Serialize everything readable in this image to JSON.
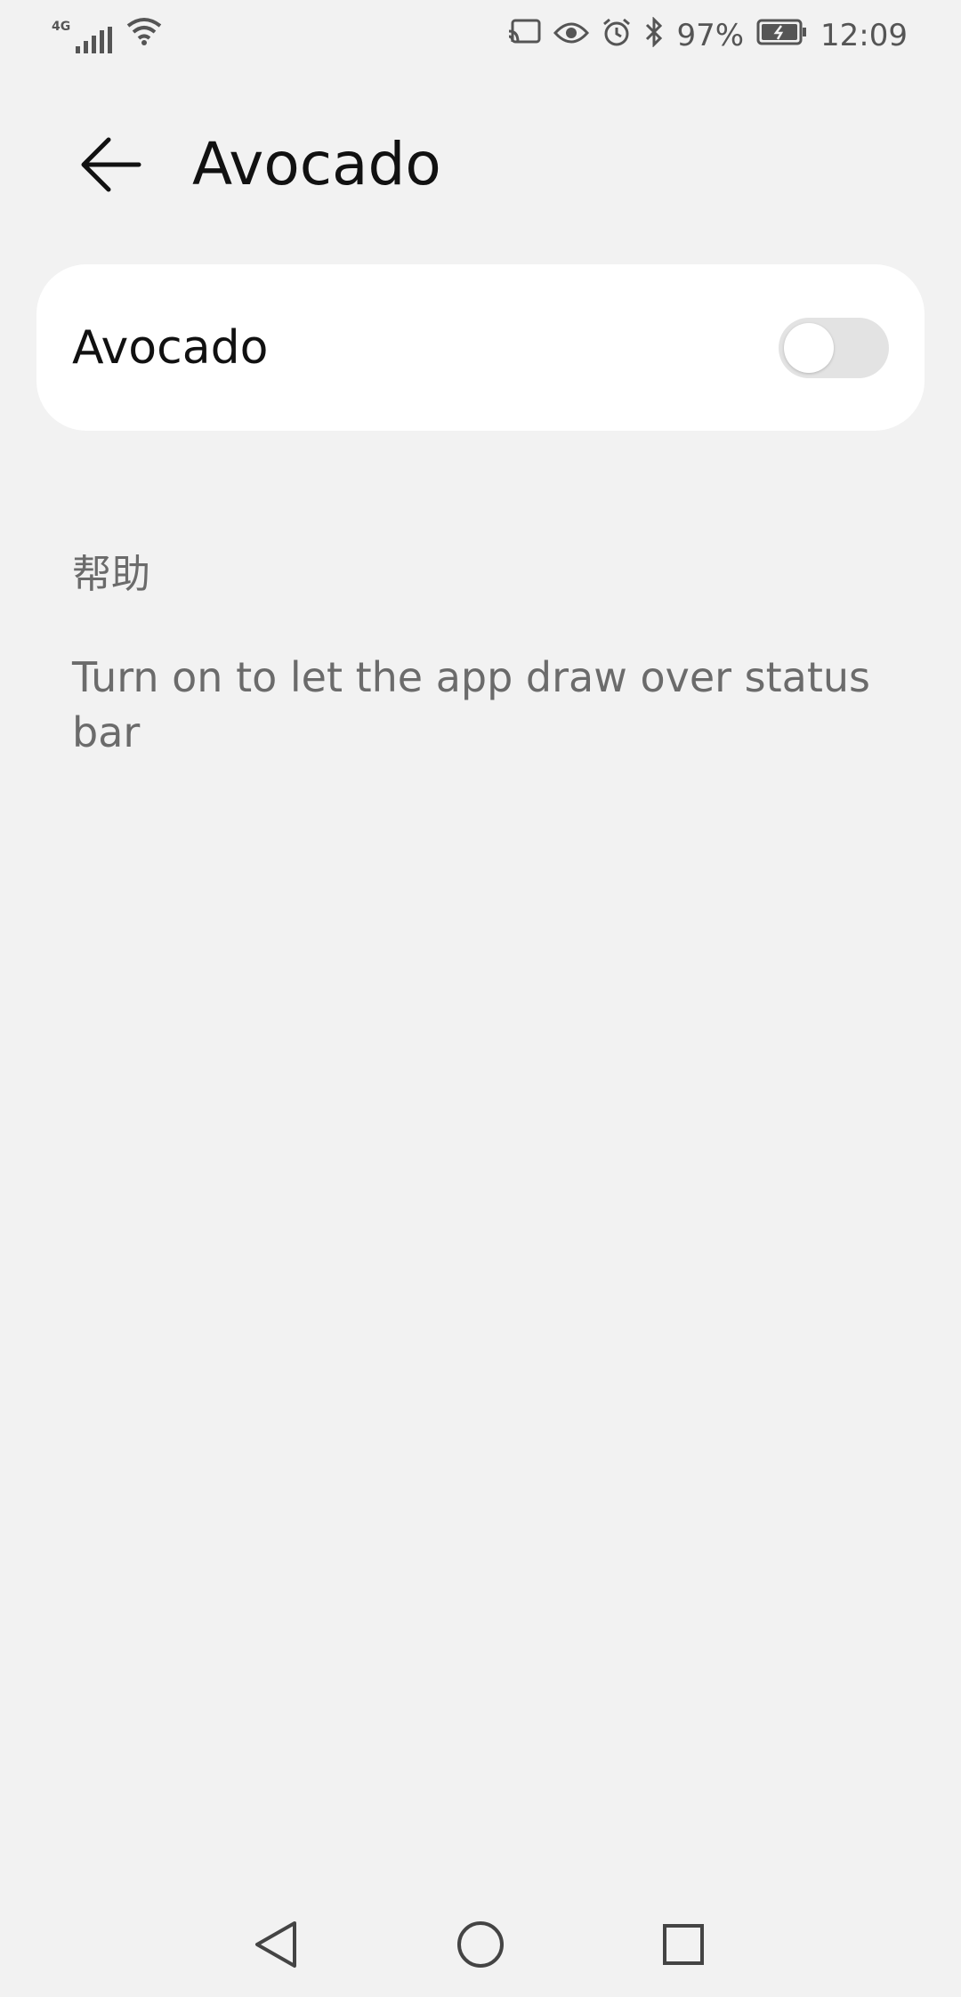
{
  "status_bar": {
    "network_label": "4G",
    "battery_percent": "97%",
    "time": "12:09",
    "icons": [
      "signal-icon",
      "wifi-icon",
      "cast-icon",
      "eye-icon",
      "alarm-icon",
      "bluetooth-icon",
      "battery-icon"
    ]
  },
  "header": {
    "title": "Avocado",
    "back_icon": "back-arrow-icon"
  },
  "setting": {
    "label": "Avocado",
    "toggle_on": false
  },
  "help": {
    "header": "帮助",
    "text": "Turn on to let the app draw over status bar"
  },
  "nav": {
    "icons": [
      "back-triangle-icon",
      "home-circle-icon",
      "recents-square-icon"
    ]
  },
  "colors": {
    "background": "#f2f2f2",
    "card": "#ffffff",
    "toggle_off": "#e3e3e3",
    "secondary_text": "#6b6b6b"
  }
}
